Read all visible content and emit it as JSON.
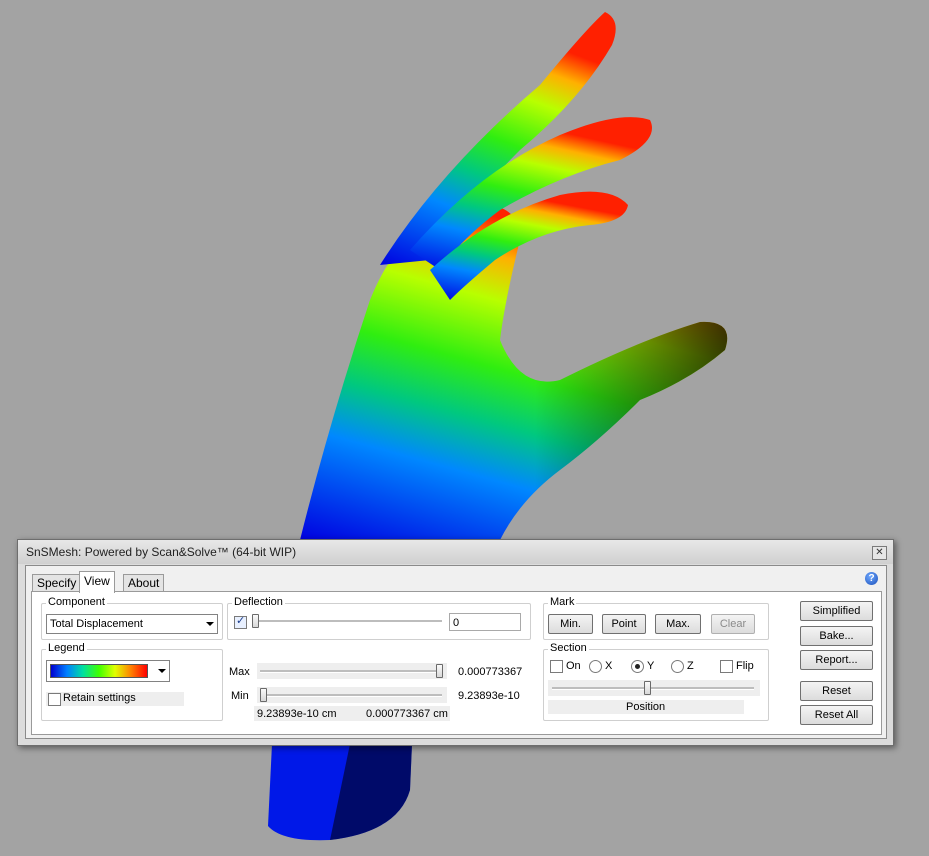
{
  "window": {
    "title": "SnSMesh: Powered by Scan&Solve™ (64-bit WIP)",
    "close_glyph": "✕"
  },
  "tabs": [
    {
      "label": "Specify",
      "active": false
    },
    {
      "label": "View",
      "active": true
    },
    {
      "label": "About",
      "active": false
    }
  ],
  "help_icon": "?",
  "component": {
    "title": "Component",
    "selected": "Total Displacement"
  },
  "legend": {
    "title": "Legend",
    "gradient_colors": [
      "#0000d0",
      "#0080ff",
      "#00e0a0",
      "#40ff00",
      "#e0ff00",
      "#ff8000",
      "#ff0000"
    ]
  },
  "retain_settings": {
    "label": "Retain settings",
    "checked": false
  },
  "deflection": {
    "title": "Deflection",
    "checked": true,
    "value": "0",
    "slider_fraction": 0.0
  },
  "range": {
    "max_label": "Max",
    "max_value": "0.000773367",
    "max_slider_fraction": 1.0,
    "min_label": "Min",
    "min_value": "9.23893e-10",
    "min_slider_fraction": 0.0,
    "min_readout": "9.23893e-10 cm",
    "max_readout": "0.000773367 cm"
  },
  "mark": {
    "title": "Mark",
    "buttons": [
      "Min.",
      "Point",
      "Max.",
      "Clear"
    ]
  },
  "section": {
    "title": "Section",
    "on_label": "On",
    "on_checked": false,
    "axes": [
      {
        "label": "X",
        "checked": false
      },
      {
        "label": "Y",
        "checked": true
      },
      {
        "label": "Z",
        "checked": false
      }
    ],
    "flip_label": "Flip",
    "flip_checked": false,
    "position_label": "Position",
    "slider_fraction": 0.47
  },
  "side_buttons": [
    "Simplified",
    "Bake...",
    "Report...",
    "Reset",
    "Reset All"
  ],
  "colors": {
    "background": "#a3a3a3",
    "dialog": "#dcdcdc",
    "panel": "#ffffff"
  }
}
